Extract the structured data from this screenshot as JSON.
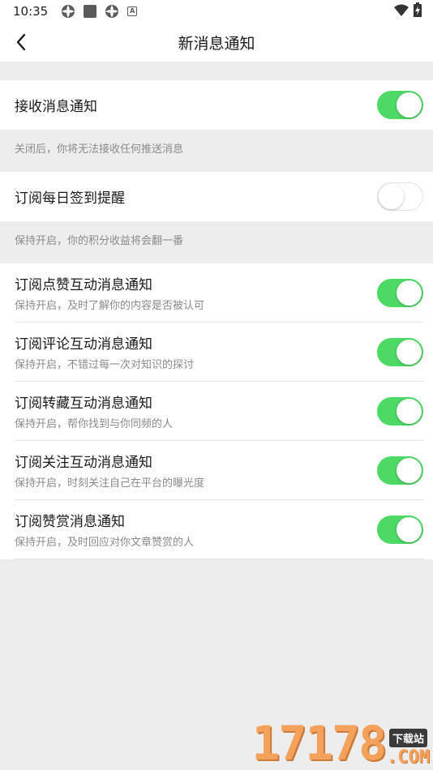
{
  "status_bar": {
    "time": "10:35",
    "icons": [
      "gear-icon",
      "app-square-icon",
      "gear-icon",
      "font-a-icon"
    ],
    "right_icons": [
      "wifi-icon",
      "battery-charging-icon"
    ]
  },
  "header": {
    "back_icon": "chevron-left-icon",
    "title": "新消息通知"
  },
  "primary": {
    "receive": {
      "title": "接收消息通知",
      "enabled": true
    },
    "receive_hint": "关闭后，你将无法接收任何推送消息",
    "checkin": {
      "title": "订阅每日签到提醒",
      "enabled": false
    },
    "checkin_hint": "保持开启，你的积分收益将会翻一番"
  },
  "subscriptions": [
    {
      "title": "订阅点赞互动消息通知",
      "subtitle": "保持开启，及时了解你的内容是否被认可",
      "enabled": true
    },
    {
      "title": "订阅评论互动消息通知",
      "subtitle": "保持开启，不错过每一次对知识的探讨",
      "enabled": true
    },
    {
      "title": "订阅转藏互动消息通知",
      "subtitle": "保持开启，帮你找到与你同频的人",
      "enabled": true
    },
    {
      "title": "订阅关注互动消息通知",
      "subtitle": "保持开启，时刻关注自己在平台的曝光度",
      "enabled": true
    },
    {
      "title": "订阅赞赏消息通知",
      "subtitle": "保持开启，及时回应对你文章赞赏的人",
      "enabled": true
    }
  ],
  "colors": {
    "toggle_on": "#4cd964",
    "background": "#ededed",
    "hint_text": "#8a8a8a"
  },
  "watermark": {
    "digits": "17178",
    "badge": "下载站",
    "suffix": ".COM"
  }
}
